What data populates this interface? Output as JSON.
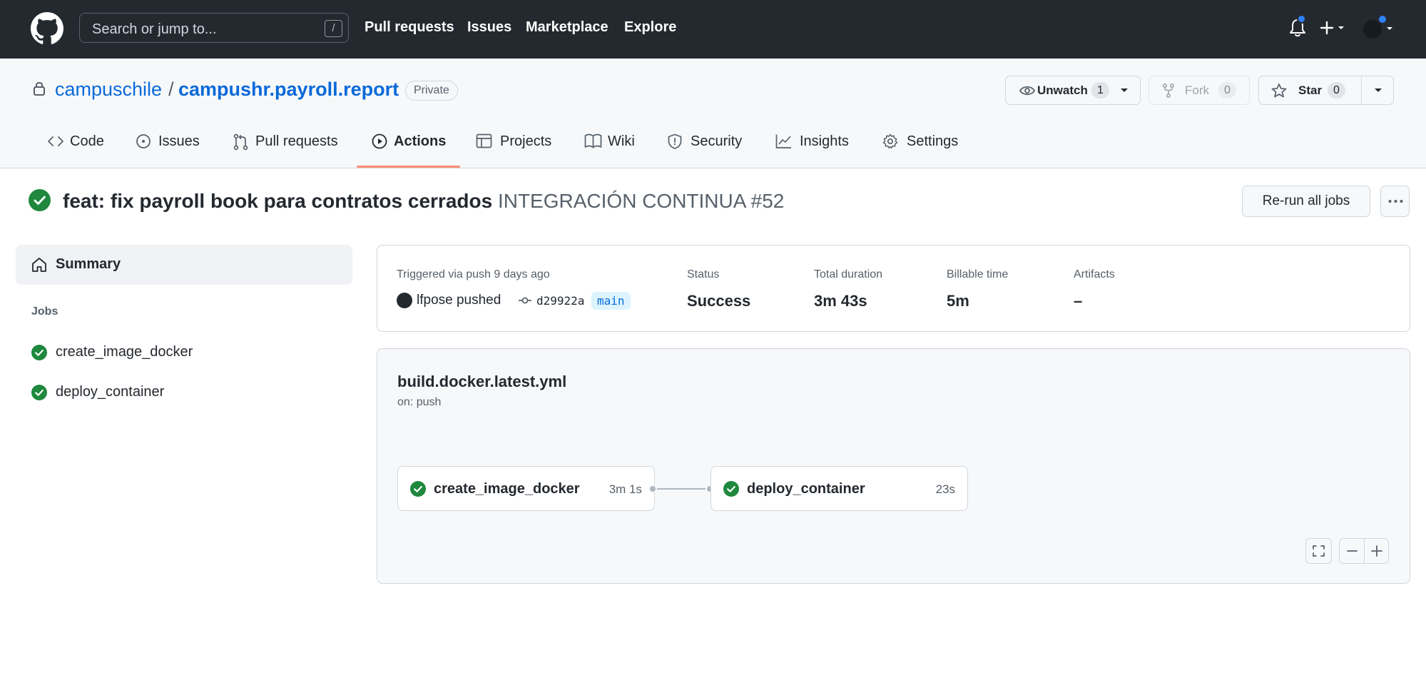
{
  "header": {
    "search_placeholder": "Search or jump to...",
    "search_shortcut": "/",
    "nav": [
      "Pull requests",
      "Issues",
      "Marketplace",
      "Explore"
    ]
  },
  "repo": {
    "owner": "campuschile",
    "separator": "/",
    "name": "campushr.payroll.report",
    "visibility": "Private",
    "watch": {
      "label": "Unwatch",
      "count": "1"
    },
    "fork": {
      "label": "Fork",
      "count": "0"
    },
    "star": {
      "label": "Star",
      "count": "0"
    },
    "tabs": [
      {
        "label": "Code",
        "icon": "code-icon"
      },
      {
        "label": "Issues",
        "icon": "issue-opened-icon"
      },
      {
        "label": "Pull requests",
        "icon": "git-pull-request-icon"
      },
      {
        "label": "Actions",
        "icon": "play-icon",
        "selected": true
      },
      {
        "label": "Projects",
        "icon": "table-icon"
      },
      {
        "label": "Wiki",
        "icon": "book-icon"
      },
      {
        "label": "Security",
        "icon": "shield-icon"
      },
      {
        "label": "Insights",
        "icon": "graph-icon"
      },
      {
        "label": "Settings",
        "icon": "gear-icon"
      }
    ]
  },
  "run": {
    "title": "feat: fix payroll book para contratos cerrados",
    "workflow_run": "INTEGRACIÓN CONTINUA #52",
    "rerun_label": "Re-run all jobs",
    "status": "success"
  },
  "sidebar": {
    "summary_label": "Summary",
    "jobs_heading": "Jobs",
    "jobs": [
      {
        "name": "create_image_docker",
        "status": "success"
      },
      {
        "name": "deploy_container",
        "status": "success"
      }
    ]
  },
  "summary": {
    "trigger_label": "Triggered via push 9 days ago",
    "actor_text": "lfpose pushed",
    "commit_sha": "d29922a",
    "branch": "main",
    "status_label": "Status",
    "status_value": "Success",
    "duration_label": "Total duration",
    "duration_value": "3m 43s",
    "billable_label": "Billable time",
    "billable_value": "5m",
    "artifacts_label": "Artifacts",
    "artifacts_value": "–"
  },
  "workflow": {
    "file": "build.docker.latest.yml",
    "trigger": "on: push",
    "jobs": [
      {
        "name": "create_image_docker",
        "time": "3m 1s"
      },
      {
        "name": "deploy_container",
        "time": "23s"
      }
    ]
  },
  "colors": {
    "header_bg": "#24292f",
    "link": "#0969da",
    "success": "#1f883d",
    "tab_underline": "#fd8c73",
    "notification_dot": "#2f81f7"
  }
}
